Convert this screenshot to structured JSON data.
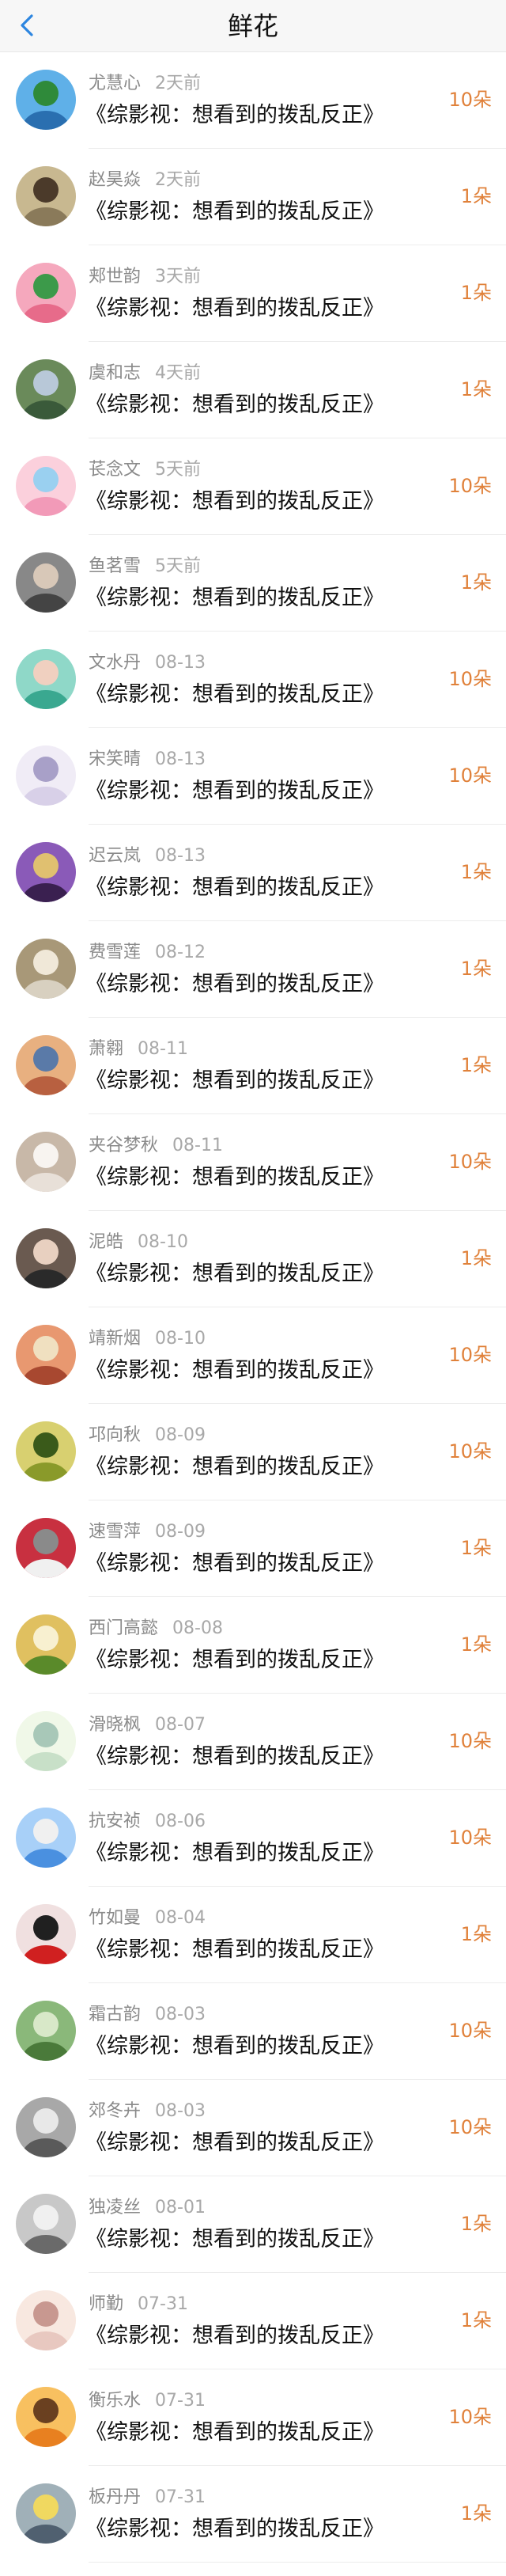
{
  "header": {
    "title": "鲜花"
  },
  "icons": {
    "back": "chevron-left-icon"
  },
  "colors": {
    "accent": "#2d86e0",
    "count": "#e0813a"
  },
  "items": [
    {
      "name": "尤慧心",
      "time": "2天前",
      "book": "《综影视：想看到的拨乱反正》",
      "count": "10朵"
    },
    {
      "name": "赵昊焱",
      "time": "2天前",
      "book": "《综影视：想看到的拨乱反正》",
      "count": "1朵"
    },
    {
      "name": "郏世韵",
      "time": "3天前",
      "book": "《综影视：想看到的拨乱反正》",
      "count": "1朵"
    },
    {
      "name": "虞和志",
      "time": "4天前",
      "book": "《综影视：想看到的拨乱反正》",
      "count": "1朵"
    },
    {
      "name": "苌念文",
      "time": "5天前",
      "book": "《综影视：想看到的拨乱反正》",
      "count": "10朵"
    },
    {
      "name": "鱼茗雪",
      "time": "5天前",
      "book": "《综影视：想看到的拨乱反正》",
      "count": "1朵"
    },
    {
      "name": "文水丹",
      "time": "08-13",
      "book": "《综影视：想看到的拨乱反正》",
      "count": "10朵"
    },
    {
      "name": "宋笑晴",
      "time": "08-13",
      "book": "《综影视：想看到的拨乱反正》",
      "count": "10朵"
    },
    {
      "name": "迟云岚",
      "time": "08-13",
      "book": "《综影视：想看到的拨乱反正》",
      "count": "1朵"
    },
    {
      "name": "费雪莲",
      "time": "08-12",
      "book": "《综影视：想看到的拨乱反正》",
      "count": "1朵"
    },
    {
      "name": "萧翱",
      "time": "08-11",
      "book": "《综影视：想看到的拨乱反正》",
      "count": "1朵"
    },
    {
      "name": "夹谷梦秋",
      "time": "08-11",
      "book": "《综影视：想看到的拨乱反正》",
      "count": "10朵"
    },
    {
      "name": "泥皓",
      "time": "08-10",
      "book": "《综影视：想看到的拨乱反正》",
      "count": "1朵"
    },
    {
      "name": "靖新烟",
      "time": "08-10",
      "book": "《综影视：想看到的拨乱反正》",
      "count": "10朵"
    },
    {
      "name": "邛向秋",
      "time": "08-09",
      "book": "《综影视：想看到的拨乱反正》",
      "count": "10朵"
    },
    {
      "name": "速雪萍",
      "time": "08-09",
      "book": "《综影视：想看到的拨乱反正》",
      "count": "1朵"
    },
    {
      "name": "西门高懿",
      "time": "08-08",
      "book": "《综影视：想看到的拨乱反正》",
      "count": "1朵"
    },
    {
      "name": "滑晓枫",
      "time": "08-07",
      "book": "《综影视：想看到的拨乱反正》",
      "count": "10朵"
    },
    {
      "name": "抗安祯",
      "time": "08-06",
      "book": "《综影视：想看到的拨乱反正》",
      "count": "10朵"
    },
    {
      "name": "竹如曼",
      "time": "08-04",
      "book": "《综影视：想看到的拨乱反正》",
      "count": "1朵"
    },
    {
      "name": "霜古韵",
      "time": "08-03",
      "book": "《综影视：想看到的拨乱反正》",
      "count": "10朵"
    },
    {
      "name": "郊冬卉",
      "time": "08-03",
      "book": "《综影视：想看到的拨乱反正》",
      "count": "10朵"
    },
    {
      "name": "独凌丝",
      "time": "08-01",
      "book": "《综影视：想看到的拨乱反正》",
      "count": "1朵"
    },
    {
      "name": "师勤",
      "time": "07-31",
      "book": "《综影视：想看到的拨乱反正》",
      "count": "1朵"
    },
    {
      "name": "衡乐水",
      "time": "07-31",
      "book": "《综影视：想看到的拨乱反正》",
      "count": "10朵"
    },
    {
      "name": "板丹丹",
      "time": "07-31",
      "book": "《综影视：想看到的拨乱反正》",
      "count": "1朵"
    }
  ]
}
